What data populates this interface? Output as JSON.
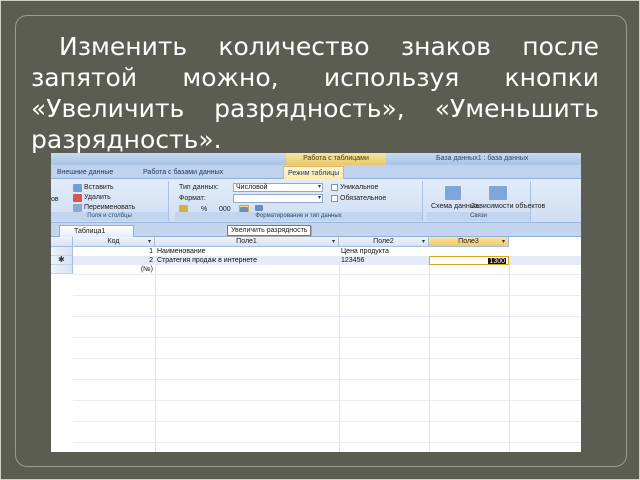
{
  "slide": {
    "caption": "Изменить количество знаков после запятой можно, используя кнопки «Увеличить разрядность», «Уменьшить разрядность»."
  },
  "app": {
    "context_group": "Работа с таблицами",
    "db_title": "База данных1 : база данных",
    "tabs": [
      {
        "label": "Внешние данные"
      },
      {
        "label": "Работа с базами данных"
      },
      {
        "label": "Режим таблицы"
      }
    ],
    "ribbon": {
      "clipboard": {
        "items": [
          "Вставить",
          "Удалить",
          "Переименовать"
        ],
        "left_partial": "ов",
        "group_label": "Поля и столбцы"
      },
      "formatting": {
        "datatype_label": "Тип данных:",
        "datatype_value": "Числовой",
        "format_label": "Формат:",
        "format_value": "",
        "percent": "%",
        "thousands": "000",
        "unique_label": "Уникальное",
        "required_label": "Обязательное",
        "group_label": "Форматирование и тип данных"
      },
      "relations": {
        "schema_label": "Схема данных",
        "dependencies_label": "Зависимости объектов",
        "group_label": "Связи"
      }
    },
    "tooltip": "Увеличить разрядность",
    "doc_tab": "Таблица1",
    "table": {
      "columns": [
        {
          "label": "Код"
        },
        {
          "label": "Поле1"
        },
        {
          "label": "Поле2"
        },
        {
          "label": "Поле3"
        }
      ],
      "rows": [
        {
          "id": "1",
          "pole1": "Наименование",
          "pole2": "Цена продукта",
          "pole3": ""
        },
        {
          "id": "2",
          "pole1": "Стратегия продаж в интернете",
          "pole2": "123456",
          "pole3": "1300"
        }
      ],
      "new_row_id": "(№)",
      "new_row_marker": "✱"
    },
    "colors": {
      "accent_selected_column": "#f5c96a",
      "ribbon_bg": "#cfdef3",
      "slide_bg": "#5b5d52"
    }
  }
}
